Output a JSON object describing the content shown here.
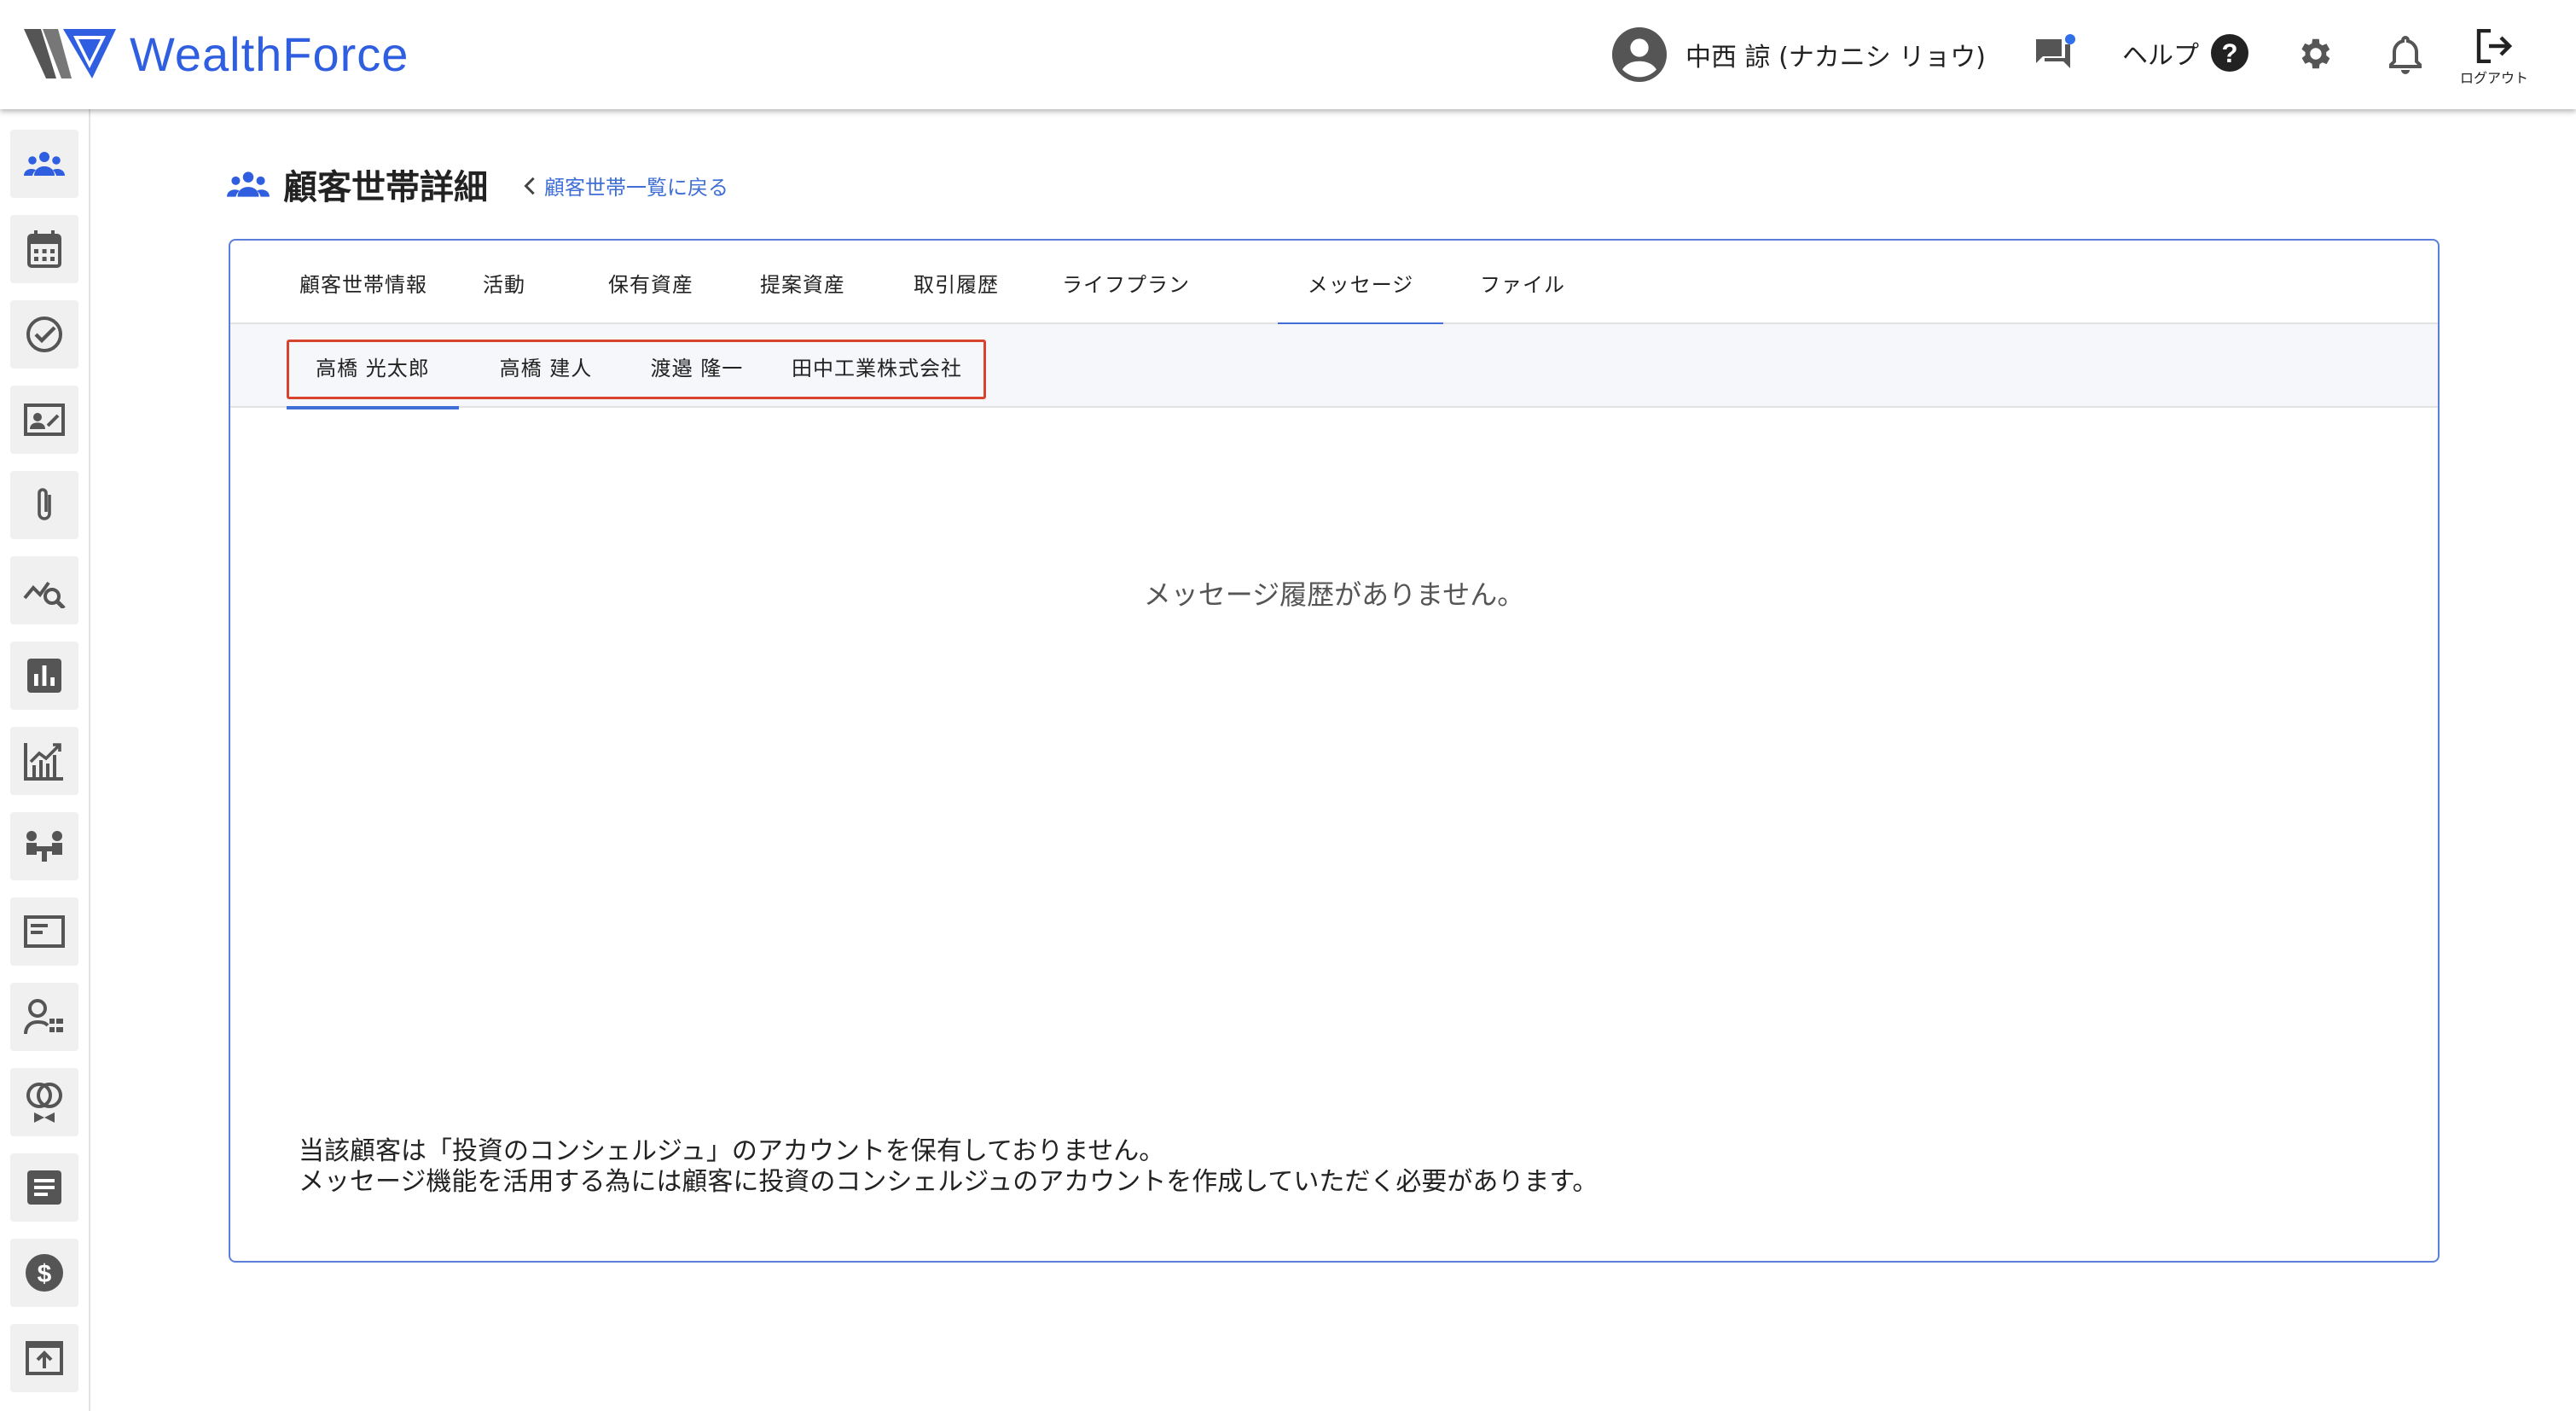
{
  "app": {
    "brand": "WealthForce",
    "brand_part1": "Wealth",
    "brand_part2": "Force",
    "accent_color": "#2f5fe0"
  },
  "header": {
    "user_name": "中西 諒 (ナカニシ リョウ)",
    "help_label": "ヘルプ",
    "logout_label": "ログアウト",
    "icons": [
      "account-circle-icon",
      "chat-icon",
      "help-icon",
      "gear-icon",
      "bell-icon",
      "logout-icon"
    ]
  },
  "sidebar": {
    "items": [
      {
        "icon": "people-icon"
      },
      {
        "icon": "calendar-icon"
      },
      {
        "icon": "check-circle-icon"
      },
      {
        "icon": "contact-card-icon"
      },
      {
        "icon": "paperclip-icon"
      },
      {
        "icon": "analytics-search-icon"
      },
      {
        "icon": "bar-chart-box-icon"
      },
      {
        "icon": "growth-chart-icon"
      },
      {
        "icon": "meeting-icon"
      },
      {
        "icon": "card-icon"
      },
      {
        "icon": "user-list-icon"
      },
      {
        "icon": "rings-icon"
      },
      {
        "icon": "document-icon"
      },
      {
        "icon": "dollar-icon"
      },
      {
        "icon": "upload-icon"
      }
    ]
  },
  "page": {
    "title": "顧客世帯詳細",
    "back_link": "顧客世帯一覧に戻る"
  },
  "tabs": [
    {
      "label": "顧客世帯情報",
      "active": false
    },
    {
      "label": "活動",
      "active": false
    },
    {
      "label": "保有資産",
      "active": false
    },
    {
      "label": "提案資産",
      "active": false
    },
    {
      "label": "取引履歴",
      "active": false
    },
    {
      "label": "ライフプラン",
      "active": false
    },
    {
      "label": "メッセージ",
      "active": true
    },
    {
      "label": "ファイル",
      "active": false
    }
  ],
  "subtabs": [
    {
      "label": "高橋 光太郎",
      "active": true
    },
    {
      "label": "高橋 建人",
      "active": false
    },
    {
      "label": "渡邉 隆一",
      "active": false
    },
    {
      "label": "田中工業株式会社",
      "active": false
    }
  ],
  "content": {
    "empty_message": "メッセージ履歴がありません。",
    "notice_line1": "当該顧客は「投資のコンシェルジュ」のアカウントを保有しておりません。",
    "notice_line2": "メッセージ機能を活用する為には顧客に投資のコンシェルジュのアカウントを作成していただく必要があります。"
  }
}
